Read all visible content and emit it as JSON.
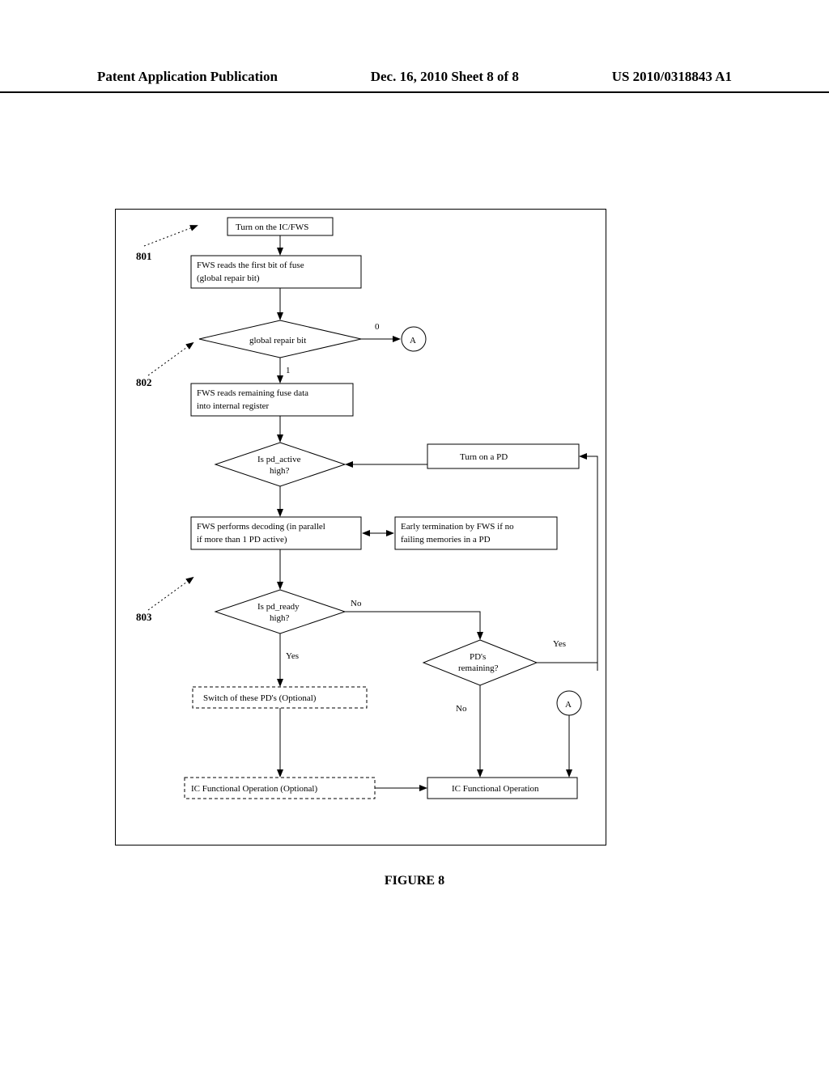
{
  "header": {
    "left": "Patent Application Publication",
    "center": "Dec. 16, 2010  Sheet 8 of 8",
    "right": "US 2010/0318843 A1"
  },
  "figure_caption": "FIGURE 8",
  "refs": {
    "r801": "801",
    "r802": "802",
    "r803": "803"
  },
  "nodes": {
    "turn_on_ic": "Turn on the IC/FWS",
    "read_first_bit_l1": "FWS reads the first bit of fuse",
    "read_first_bit_l2": "(global repair bit)",
    "global_repair_bit": "global repair bit",
    "zero": "0",
    "one": "1",
    "A": "A",
    "read_remaining_l1": "FWS reads remaining fuse data",
    "read_remaining_l2": "into internal register",
    "is_pd_active_l1": "Is pd_active",
    "is_pd_active_l2": "high?",
    "turn_on_pd": "Turn on a PD",
    "fws_decode_l1": "FWS performs decoding (in parallel",
    "fws_decode_l2": "if more than 1 PD active)",
    "early_term_l1": "Early termination by FWS if no",
    "early_term_l2": "failing memories in a PD",
    "is_pd_ready_l1": "Is pd_ready",
    "is_pd_ready_l2": "high?",
    "no": "No",
    "yes": "Yes",
    "pds_remaining_l1": "PD's",
    "pds_remaining_l2": "remaining?",
    "switch_off": "Switch of these PD's (Optional)",
    "ic_func_opt": "IC Functional Operation (Optional)",
    "ic_func": "IC Functional Operation"
  }
}
